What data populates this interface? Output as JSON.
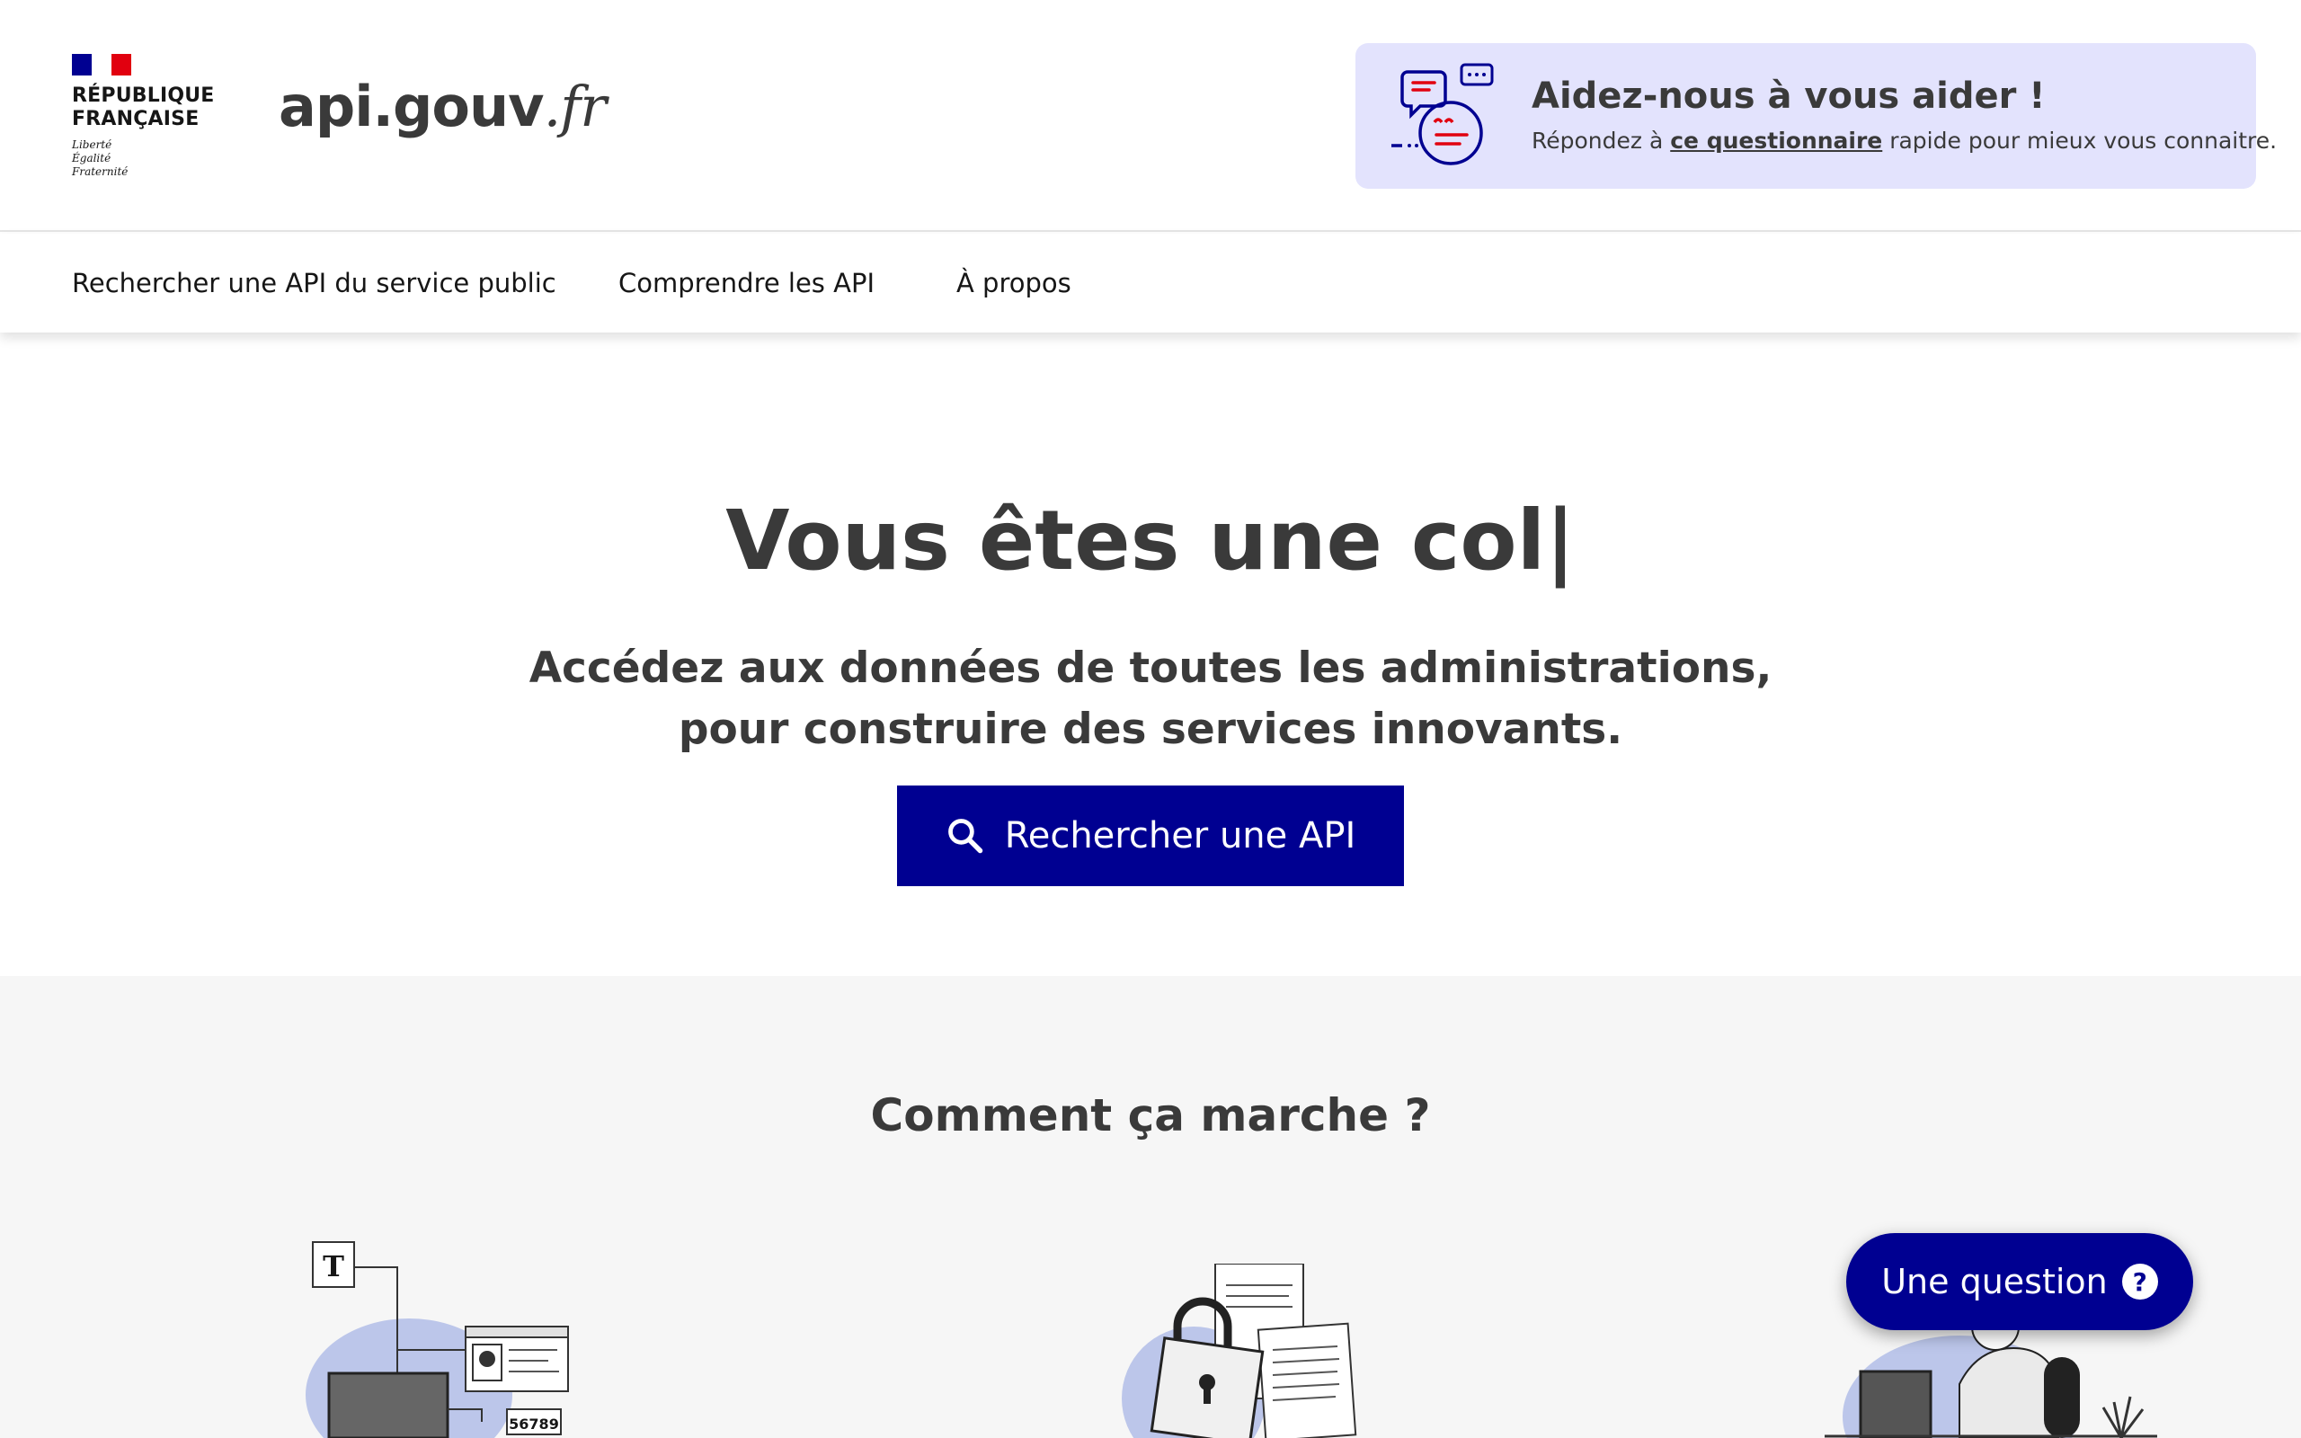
{
  "header": {
    "republic_line1": "RÉPUBLIQUE",
    "republic_line2": "FRANÇAISE",
    "motto_1": "Liberté",
    "motto_2": "Égalité",
    "motto_3": "Fraternité",
    "site_name_main": "api.gouv",
    "site_name_tld": ".fr"
  },
  "help_banner": {
    "title": "Aidez-nous à vous aider !",
    "text_before": "Répondez à ",
    "link_label": "ce questionnaire",
    "text_after": " rapide pour mieux vous connaitre."
  },
  "nav": {
    "items": [
      {
        "label": "Rechercher une API du service public"
      },
      {
        "label": "Comprendre les API"
      },
      {
        "label": "À propos"
      }
    ]
  },
  "hero": {
    "title": "Vous êtes une col|",
    "subtitle_line1": "Accédez aux données de toutes les administrations,",
    "subtitle_line2": "pour construire des services innovants.",
    "search_button_label": "Rechercher une API"
  },
  "how": {
    "title": "Comment ça marche ?",
    "illus1_letter": "T",
    "illus1_number": "56789"
  },
  "chat": {
    "question_label": "Une question",
    "question_icon_glyph": "?"
  },
  "colors": {
    "primary": "#000091",
    "banner_bg": "#e3e3fd",
    "section_bg": "#f6f6f6",
    "marianne_red": "#e1000f"
  }
}
